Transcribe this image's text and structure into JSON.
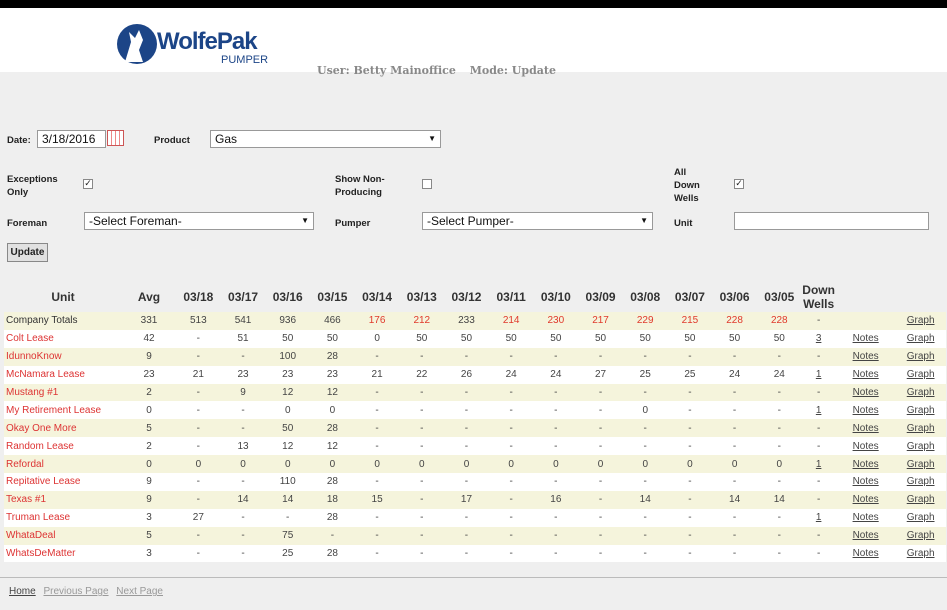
{
  "header": {
    "logo_main": "WolfePak",
    "logo_sub": "PUMPER",
    "user": "User: Betty Mainoffice",
    "mode": "Mode: Update"
  },
  "form": {
    "date_label": "Date:",
    "date_value": "3/18/2016",
    "product_label": "Product",
    "product_value": "Gas",
    "exceptions_label": "Exceptions Only",
    "exceptions_checked": true,
    "nonproducing_label": "Show Non-Producing",
    "nonproducing_checked": false,
    "downwells_label": "All Down Wells",
    "downwells_checked": true,
    "foreman_label": "Foreman",
    "foreman_value": "-Select Foreman-",
    "pumper_label": "Pumper",
    "pumper_value": "-Select Pumper-",
    "unit_label": "Unit",
    "unit_value": "",
    "update_label": "Update"
  },
  "table": {
    "headers": [
      "Unit",
      "Avg",
      "03/18",
      "03/17",
      "03/16",
      "03/15",
      "03/14",
      "03/13",
      "03/12",
      "03/11",
      "03/10",
      "03/09",
      "03/08",
      "03/07",
      "03/06",
      "03/05",
      "Down Wells"
    ],
    "totals": {
      "unit": "Company Totals",
      "values": [
        "331",
        "513",
        "541",
        "936",
        "466",
        "176",
        "212",
        "233",
        "214",
        "230",
        "217",
        "229",
        "215",
        "228",
        "228"
      ],
      "red": [
        false,
        false,
        false,
        false,
        false,
        true,
        true,
        false,
        true,
        true,
        true,
        true,
        true,
        true,
        true
      ],
      "down": "-",
      "graph": "Graph"
    },
    "notes_label": "Notes",
    "graph_label": "Graph",
    "rows": [
      {
        "unit": "Colt Lease",
        "values": [
          "42",
          "-",
          "51",
          "50",
          "50",
          "0",
          "50",
          "50",
          "50",
          "50",
          "50",
          "50",
          "50",
          "50",
          "50"
        ],
        "down": "3"
      },
      {
        "unit": "IdunnoKnow",
        "values": [
          "9",
          "-",
          "-",
          "100",
          "28",
          "-",
          "-",
          "-",
          "-",
          "-",
          "-",
          "-",
          "-",
          "-",
          "-"
        ],
        "down": "-"
      },
      {
        "unit": "McNamara Lease",
        "values": [
          "23",
          "21",
          "23",
          "23",
          "23",
          "21",
          "22",
          "26",
          "24",
          "24",
          "27",
          "25",
          "25",
          "24",
          "24"
        ],
        "down": "1"
      },
      {
        "unit": "Mustang #1",
        "values": [
          "2",
          "-",
          "9",
          "12",
          "12",
          "-",
          "-",
          "-",
          "-",
          "-",
          "-",
          "-",
          "-",
          "-",
          "-"
        ],
        "down": "-"
      },
      {
        "unit": "My Retirement Lease",
        "values": [
          "0",
          "-",
          "-",
          "0",
          "0",
          "-",
          "-",
          "-",
          "-",
          "-",
          "-",
          "0",
          "-",
          "-",
          "-"
        ],
        "down": "1"
      },
      {
        "unit": "Okay One More",
        "values": [
          "5",
          "-",
          "-",
          "50",
          "28",
          "-",
          "-",
          "-",
          "-",
          "-",
          "-",
          "-",
          "-",
          "-",
          "-"
        ],
        "down": "-"
      },
      {
        "unit": "Random Lease",
        "values": [
          "2",
          "-",
          "13",
          "12",
          "12",
          "-",
          "-",
          "-",
          "-",
          "-",
          "-",
          "-",
          "-",
          "-",
          "-"
        ],
        "down": "-"
      },
      {
        "unit": "Refordal",
        "values": [
          "0",
          "0",
          "0",
          "0",
          "0",
          "0",
          "0",
          "0",
          "0",
          "0",
          "0",
          "0",
          "0",
          "0",
          "0"
        ],
        "down": "1"
      },
      {
        "unit": "Repitative Lease",
        "values": [
          "9",
          "-",
          "-",
          "110",
          "28",
          "-",
          "-",
          "-",
          "-",
          "-",
          "-",
          "-",
          "-",
          "-",
          "-"
        ],
        "down": "-"
      },
      {
        "unit": "Texas #1",
        "values": [
          "9",
          "-",
          "14",
          "14",
          "18",
          "15",
          "-",
          "17",
          "-",
          "16",
          "-",
          "14",
          "-",
          "14",
          "14"
        ],
        "down": "-"
      },
      {
        "unit": "Truman Lease",
        "values": [
          "3",
          "27",
          "-",
          "-",
          "28",
          "-",
          "-",
          "-",
          "-",
          "-",
          "-",
          "-",
          "-",
          "-",
          "-"
        ],
        "down": "1"
      },
      {
        "unit": "WhataDeal",
        "values": [
          "5",
          "-",
          "-",
          "75",
          "-",
          "-",
          "-",
          "-",
          "-",
          "-",
          "-",
          "-",
          "-",
          "-",
          "-"
        ],
        "down": "-"
      },
      {
        "unit": "WhatsDeMatter",
        "values": [
          "3",
          "-",
          "-",
          "25",
          "28",
          "-",
          "-",
          "-",
          "-",
          "-",
          "-",
          "-",
          "-",
          "-",
          "-"
        ],
        "down": "-"
      }
    ]
  },
  "footer": {
    "home": "Home",
    "prev": "Previous Page",
    "next": "Next Page"
  },
  "colors": {
    "brand": "#1c4587",
    "unit_link": "#d33333",
    "highlight": "#e0392b",
    "row_alt": "#f5f4dc"
  }
}
